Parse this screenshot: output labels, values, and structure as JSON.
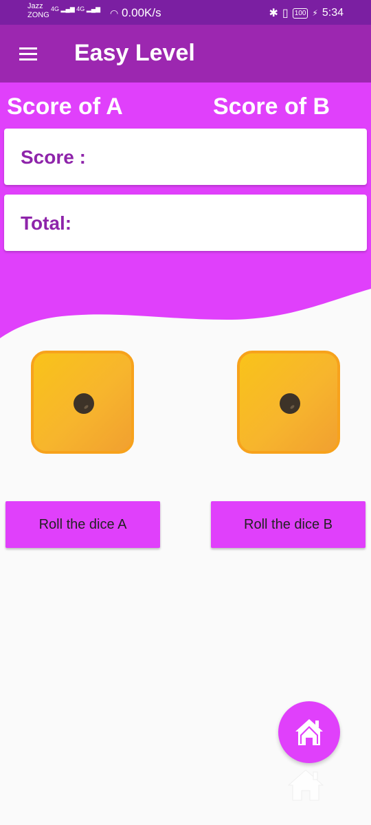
{
  "status_bar": {
    "carrier1": "Jazz",
    "carrier2": "ZONG",
    "network": "4G",
    "speed": "0.00K/s",
    "battery": "100",
    "time": "5:34"
  },
  "app_bar": {
    "title": "Easy Level",
    "menu_icon": "menu-icon"
  },
  "scores": {
    "label_a": "Score of A",
    "label_b": "Score of B",
    "score_label": "Score :",
    "total_label": "Total:"
  },
  "dice": {
    "a_face": 1,
    "b_face": 1
  },
  "buttons": {
    "roll_a": "Roll the dice A",
    "roll_b": "Roll the dice B"
  },
  "fab": {
    "icon": "home-icon"
  },
  "colors": {
    "appbar": "#9c27b0",
    "statusbar": "#7b1fa2",
    "accent": "#e040fb",
    "label_text": "#8e24aa",
    "die": "#f9c31a"
  }
}
